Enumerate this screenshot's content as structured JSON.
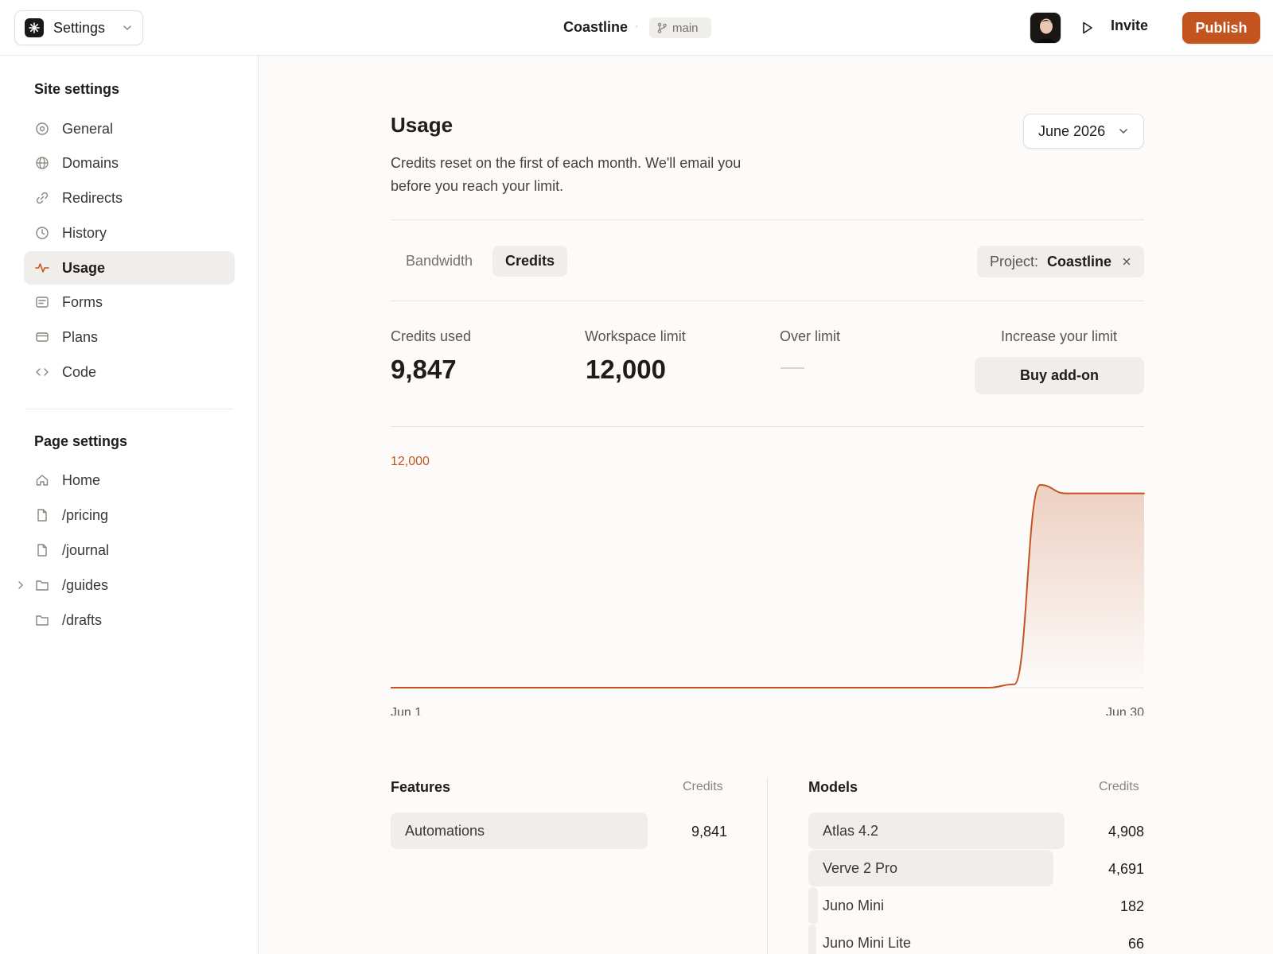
{
  "topbar": {
    "settings_label": "Settings",
    "project_name": "Coastline",
    "separator": "·",
    "branch": "main",
    "invite_label": "Invite",
    "publish_label": "Publish"
  },
  "colors": {
    "accent": "#c4541f",
    "surface": "#f0eeeb",
    "background": "#fcfbfa"
  },
  "sidebar": {
    "site_heading": "Site settings",
    "site_items": [
      {
        "label": "General",
        "icon": "gear-circle-icon"
      },
      {
        "label": "Domains",
        "icon": "globe-icon"
      },
      {
        "label": "Redirects",
        "icon": "link-icon"
      },
      {
        "label": "History",
        "icon": "clock-icon"
      },
      {
        "label": "Usage",
        "icon": "activity-icon",
        "active": true
      },
      {
        "label": "Forms",
        "icon": "form-icon"
      },
      {
        "label": "Plans",
        "icon": "card-icon"
      },
      {
        "label": "Code",
        "icon": "code-icon"
      }
    ],
    "page_heading": "Page settings",
    "page_items": [
      {
        "label": "Home",
        "icon": "home-icon"
      },
      {
        "label": "/pricing",
        "icon": "file-icon"
      },
      {
        "label": "/journal",
        "icon": "file-icon"
      },
      {
        "label": "/guides",
        "icon": "folder-icon",
        "expandable": true
      },
      {
        "label": "/drafts",
        "icon": "folder-icon"
      }
    ]
  },
  "usage": {
    "title": "Usage",
    "description": "Credits reset on the first of each month. We'll email you before you reach your limit.",
    "month": "June 2026",
    "tabs": [
      {
        "label": "Bandwidth",
        "active": false
      },
      {
        "label": "Credits",
        "active": true
      }
    ],
    "filter": {
      "label": "Project:",
      "value": "Coastline"
    },
    "stats": {
      "credits_used_label": "Credits used",
      "credits_used_value": "9,847",
      "workspace_limit_label": "Workspace limit",
      "workspace_limit_value": "12,000",
      "over_limit_label": "Over limit",
      "increase_label": "Increase your limit",
      "buy_label": "Buy add-on"
    }
  },
  "chart_data": {
    "type": "area",
    "limit_label": "12,000",
    "ylim": [
      0,
      12000
    ],
    "x_tick_labels": [
      "Jun 1",
      "Jun 30"
    ],
    "x": [
      1,
      24,
      25,
      26,
      27,
      30
    ],
    "values": [
      0,
      0,
      200,
      12000,
      11500,
      11500
    ]
  },
  "features": {
    "heading": "Features",
    "column": "Credits",
    "rows": [
      {
        "label": "Automations",
        "value": "9,841",
        "share": 1.0
      }
    ]
  },
  "models": {
    "heading": "Models",
    "column": "Credits",
    "rows": [
      {
        "label": "Atlas 4.2",
        "value": "4,908",
        "share": 1.0
      },
      {
        "label": "Verve 2 Pro",
        "value": "4,691",
        "share": 0.955
      },
      {
        "label": "Juno Mini",
        "value": "182",
        "share": 0.037
      },
      {
        "label": "Juno Mini Lite",
        "value": "66",
        "share": 0.013
      }
    ]
  }
}
